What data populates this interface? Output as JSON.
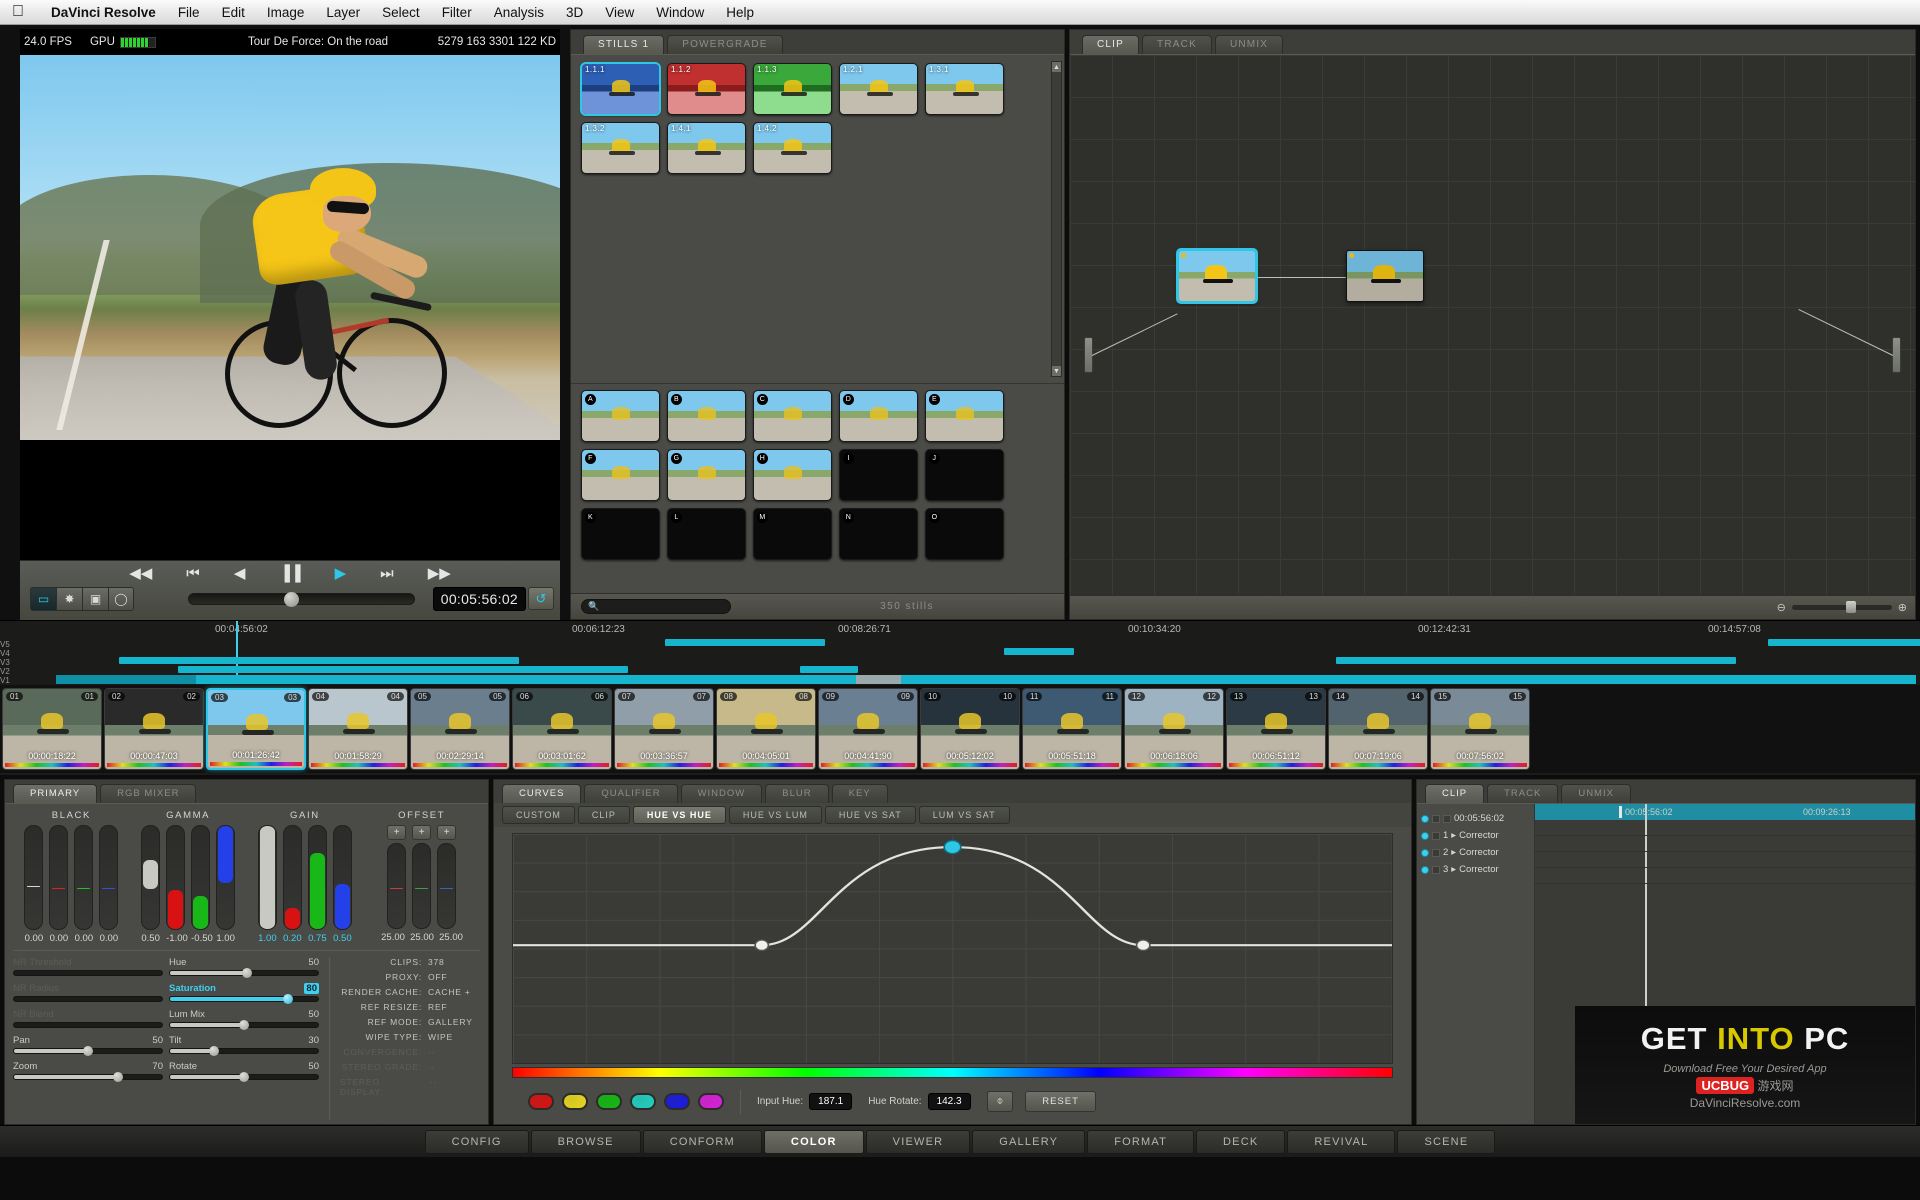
{
  "menubar": {
    "apple_icon": "apple-icon",
    "items": [
      "DaVinci Resolve",
      "File",
      "Edit",
      "Image",
      "Layer",
      "Select",
      "Filter",
      "Analysis",
      "3D",
      "View",
      "Window",
      "Help"
    ]
  },
  "viewer": {
    "fps": "24.0 FPS",
    "gpu_label": "GPU",
    "title": "Tour De Force: On the road",
    "numbers": "5279 163 3301 122 KD",
    "timecode": "00:05:56:02",
    "transport": {
      "rewind": "◀◀",
      "prev_clip": "⏮",
      "step_back": "◀",
      "pause": "▐▐",
      "play": "▶",
      "next_clip": "⏭",
      "forward": "▶▶"
    },
    "tools": [
      "camera-icon",
      "eyedropper-icon",
      "display-icon",
      "brush-icon"
    ],
    "loop_icon": "loop-icon"
  },
  "gallery": {
    "tabs": [
      {
        "label": "STILLS 1",
        "active": true
      },
      {
        "label": "POWERGRADE",
        "active": false
      }
    ],
    "stills_top": [
      {
        "label": "1.1.1",
        "selected": true,
        "tint": "blue"
      },
      {
        "label": "1.1.2",
        "selected": false,
        "tint": "red"
      },
      {
        "label": "1.1.3",
        "selected": false,
        "tint": "green"
      },
      {
        "label": "1.2.1",
        "selected": false,
        "tint": "normal"
      },
      {
        "label": "1.3.1",
        "selected": false,
        "tint": "normal"
      },
      {
        "label": "1.3.2",
        "selected": false,
        "tint": "normal"
      },
      {
        "label": "1.4.1",
        "selected": false,
        "tint": "normal"
      },
      {
        "label": "1.4.2",
        "selected": false,
        "tint": "normal"
      }
    ],
    "stills_bottom": [
      {
        "label": "A",
        "empty": false
      },
      {
        "label": "B",
        "empty": false
      },
      {
        "label": "C",
        "empty": false
      },
      {
        "label": "D",
        "empty": false
      },
      {
        "label": "E",
        "empty": false
      },
      {
        "label": "F",
        "empty": false
      },
      {
        "label": "G",
        "empty": false
      },
      {
        "label": "H",
        "empty": false
      },
      {
        "label": "I",
        "empty": true
      },
      {
        "label": "J",
        "empty": true
      },
      {
        "label": "K",
        "empty": true
      },
      {
        "label": "L",
        "empty": true
      },
      {
        "label": "M",
        "empty": true
      },
      {
        "label": "N",
        "empty": true
      },
      {
        "label": "O",
        "empty": true
      }
    ],
    "search_icon": "search-icon",
    "count_label": "350 stills"
  },
  "node_editor": {
    "tabs": [
      {
        "label": "CLIP",
        "active": true
      },
      {
        "label": "TRACK",
        "active": false
      },
      {
        "label": "UNMIX",
        "active": false
      }
    ],
    "nodes": [
      {
        "number": "1",
        "selected": true
      },
      {
        "number": "2",
        "selected": false
      }
    ],
    "zoom_out_icon": "zoom-out-icon",
    "zoom_in_icon": "zoom-in-icon"
  },
  "timeline": {
    "ruler_marks": [
      "00:04:56:02",
      "00:06:12:23",
      "00:08:26:71",
      "00:10:34:20",
      "00:12:42:31",
      "00:14:57:08"
    ],
    "lanes": [
      "V5",
      "V4",
      "V3",
      "V2",
      "V1"
    ],
    "clips": [
      {
        "num": "01",
        "tc": "00:00:18:22",
        "selected": false
      },
      {
        "num": "02",
        "tc": "00:00:47:03",
        "selected": false
      },
      {
        "num": "03",
        "tc": "00:01:26:42",
        "selected": true
      },
      {
        "num": "04",
        "tc": "00:01:58:29",
        "selected": false
      },
      {
        "num": "05",
        "tc": "00:02:29:14",
        "selected": false
      },
      {
        "num": "06",
        "tc": "00:03:01:62",
        "selected": false
      },
      {
        "num": "07",
        "tc": "00:03:36:57",
        "selected": false
      },
      {
        "num": "08",
        "tc": "00:04:05:01",
        "selected": false
      },
      {
        "num": "09",
        "tc": "00:04:41:90",
        "selected": false
      },
      {
        "num": "10",
        "tc": "00:05:12:02",
        "selected": false
      },
      {
        "num": "11",
        "tc": "00:05:51:18",
        "selected": false
      },
      {
        "num": "12",
        "tc": "00:06:18:06",
        "selected": false
      },
      {
        "num": "13",
        "tc": "00:06:51:12",
        "selected": false
      },
      {
        "num": "14",
        "tc": "00:07:19:06",
        "selected": false
      },
      {
        "num": "15",
        "tc": "00:07:56:02",
        "selected": false
      }
    ]
  },
  "primary": {
    "tabs": [
      {
        "label": "PRIMARY",
        "active": true
      },
      {
        "label": "RGB MIXER",
        "active": false
      }
    ],
    "groups": [
      {
        "title": "BLACK",
        "values": [
          "0.00",
          "0.00",
          "0.00",
          "0.00"
        ],
        "highlight": false
      },
      {
        "title": "GAMMA",
        "values": [
          "0.50",
          "-1.00",
          "-0.50",
          "1.00"
        ],
        "highlight": false
      },
      {
        "title": "GAIN",
        "values": [
          "1.00",
          "0.20",
          "0.75",
          "0.50"
        ],
        "highlight": true
      },
      {
        "title": "OFFSET",
        "values": [
          "25.00",
          "25.00",
          "25.00"
        ],
        "highlight": false
      }
    ],
    "offset_buttons": [
      "+",
      "+",
      "+"
    ],
    "left_controls": [
      {
        "label": "NR Threshold",
        "value": "",
        "dim": true,
        "fill": 0
      },
      {
        "label": "NR Radius",
        "value": "",
        "dim": true,
        "fill": 0
      },
      {
        "label": "NR Blend",
        "value": "",
        "dim": true,
        "fill": 0
      },
      {
        "label": "Pan",
        "value": "50",
        "dim": false,
        "fill": 50
      },
      {
        "label": "Zoom",
        "value": "70",
        "dim": false,
        "fill": 70
      }
    ],
    "mid_controls": [
      {
        "label": "Hue",
        "value": "50",
        "active": false,
        "fill": 52
      },
      {
        "label": "Saturation",
        "value": "80",
        "active": true,
        "fill": 80
      },
      {
        "label": "Lum Mix",
        "value": "50",
        "active": false,
        "fill": 50
      },
      {
        "label": "Tilt",
        "value": "30",
        "active": false,
        "fill": 30
      },
      {
        "label": "Rotate",
        "value": "50",
        "active": false,
        "fill": 50
      }
    ],
    "info": [
      {
        "key": "CLIPS:",
        "value": "378",
        "dim": false
      },
      {
        "key": "PROXY:",
        "value": "OFF",
        "dim": false
      },
      {
        "key": "RENDER CACHE:",
        "value": "CACHE +",
        "dim": false
      },
      {
        "key": "REF RESIZE:",
        "value": "REF",
        "dim": false
      },
      {
        "key": "REF MODE:",
        "value": "GALLERY",
        "dim": false
      },
      {
        "key": "WIPE TYPE:",
        "value": "WIPE",
        "dim": false
      },
      {
        "key": "CONVERGENCE:",
        "value": "--",
        "dim": true
      },
      {
        "key": "STEREO GRADE:",
        "value": "--",
        "dim": true
      },
      {
        "key": "STEREO DISPLAY:",
        "value": "--",
        "dim": true
      }
    ]
  },
  "curves": {
    "tabs_row1": [
      {
        "label": "CURVES",
        "active": true
      },
      {
        "label": "QUALIFIER",
        "active": false
      },
      {
        "label": "WINDOW",
        "active": false
      },
      {
        "label": "BLUR",
        "active": false
      },
      {
        "label": "KEY",
        "active": false
      }
    ],
    "tabs_row2": [
      {
        "label": "CUSTOM",
        "active": false
      },
      {
        "label": "CLIP",
        "active": false
      },
      {
        "label": "HUE VS HUE",
        "active": true
      },
      {
        "label": "HUE VS LUM",
        "active": false
      },
      {
        "label": "HUE VS SAT",
        "active": false
      },
      {
        "label": "LUM VS SAT",
        "active": false
      }
    ],
    "swatches": [
      "#d81212",
      "#e8d620",
      "#14b814",
      "#20cfc0",
      "#1a1ae0",
      "#d820d8"
    ],
    "input_hue_label": "Input Hue:",
    "input_hue_value": "187.1",
    "hue_rotate_label": "Hue Rotate:",
    "hue_rotate_value": "142.3",
    "picker_icon": "eyedropper-icon",
    "reset_label": "RESET"
  },
  "keyframes": {
    "tabs": [
      {
        "label": "CLIP",
        "active": true
      },
      {
        "label": "TRACK",
        "active": false
      },
      {
        "label": "UNMIX",
        "active": false
      }
    ],
    "timecode_start": "00:05:56:02",
    "ruler_left": "00:05:56:02",
    "ruler_right": "00:09:26:13",
    "rows": [
      {
        "num": "1",
        "label": "Corrector"
      },
      {
        "num": "2",
        "label": "Corrector"
      },
      {
        "num": "3",
        "label": "Corrector"
      }
    ]
  },
  "watermark": {
    "line1_a": "GET ",
    "line1_b": "INTO",
    "line1_c": " PC",
    "line2": "Download Free Your Desired App",
    "badge": "UCBUG",
    "cn": "游戏网",
    "line3": "DaVinciResolve.com"
  },
  "footer": {
    "buttons": [
      {
        "label": "CONFIG",
        "active": false
      },
      {
        "label": "BROWSE",
        "active": false
      },
      {
        "label": "CONFORM",
        "active": false
      },
      {
        "label": "COLOR",
        "active": true
      },
      {
        "label": "VIEWER",
        "active": false
      },
      {
        "label": "GALLERY",
        "active": false
      },
      {
        "label": "FORMAT",
        "active": false
      },
      {
        "label": "DECK",
        "active": false
      },
      {
        "label": "REVIVAL",
        "active": false
      },
      {
        "label": "SCENE",
        "active": false
      }
    ]
  }
}
